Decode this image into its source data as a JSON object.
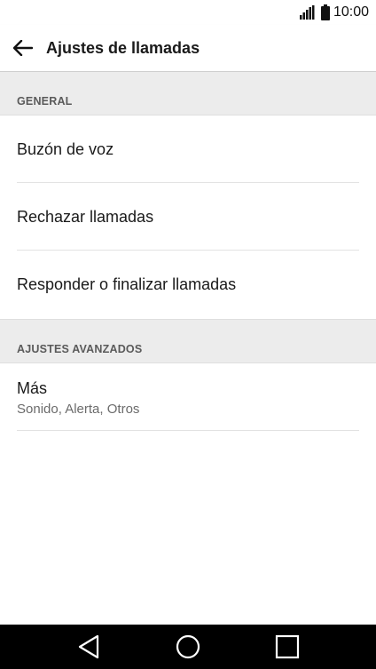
{
  "status_bar": {
    "time": "10:00",
    "signal_icon": "signal-icon",
    "battery_icon": "battery-icon"
  },
  "app_bar": {
    "back_icon": "arrow-back-icon",
    "title": "Ajustes de llamadas"
  },
  "sections": [
    {
      "header": "GENERAL",
      "items": [
        {
          "label": "Buzón de voz"
        },
        {
          "label": "Rechazar llamadas"
        },
        {
          "label": "Responder o finalizar llamadas"
        }
      ]
    },
    {
      "header": "AJUSTES AVANZADOS",
      "items": [
        {
          "label": "Más",
          "sublabel": "Sonido, Alerta, Otros"
        }
      ]
    }
  ],
  "nav_bar": {
    "back_icon": "nav-back-triangle-icon",
    "home_icon": "nav-home-circle-icon",
    "recents_icon": "nav-recents-square-icon"
  },
  "colors": {
    "section_header_bg": "#ececec",
    "nav_bar_bg": "#000000",
    "text_primary": "#1a1a1a",
    "text_secondary": "#6b6b6b"
  }
}
